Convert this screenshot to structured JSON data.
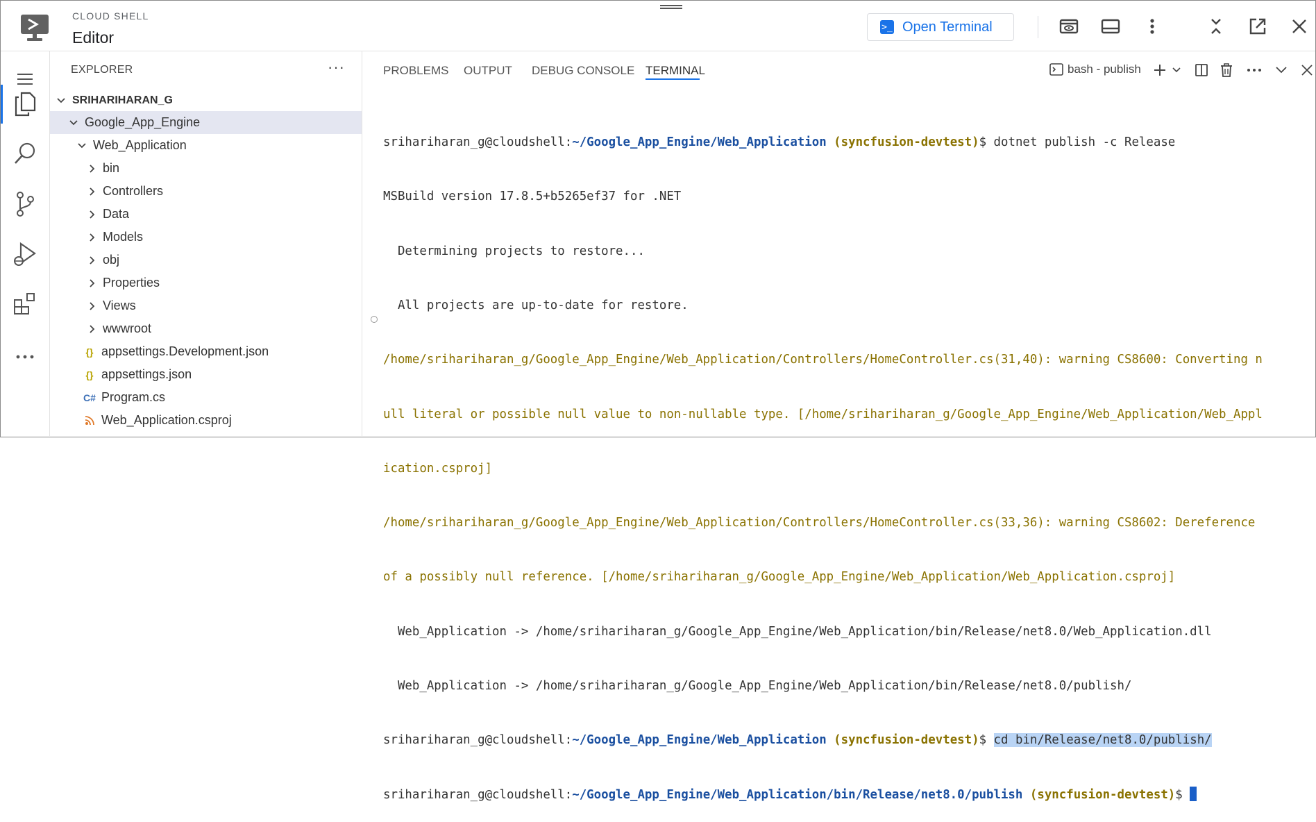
{
  "header": {
    "product": "CLOUD SHELL",
    "title": "Editor",
    "open_terminal_label": "Open Terminal"
  },
  "explorer": {
    "title": "EXPLORER",
    "root": "SRIHARIHARAN_G",
    "items": [
      {
        "label": "Google_App_Engine"
      },
      {
        "label": "Web_Application"
      },
      {
        "label": "bin"
      },
      {
        "label": "Controllers"
      },
      {
        "label": "Data"
      },
      {
        "label": "Models"
      },
      {
        "label": "obj"
      },
      {
        "label": "Properties"
      },
      {
        "label": "Views"
      },
      {
        "label": "wwwroot"
      },
      {
        "label": "appsettings.Development.json"
      },
      {
        "label": "appsettings.json"
      },
      {
        "label": "Program.cs"
      },
      {
        "label": "Web_Application.csproj"
      }
    ]
  },
  "panel": {
    "tabs": [
      {
        "label": "PROBLEMS"
      },
      {
        "label": "OUTPUT"
      },
      {
        "label": "DEBUG CONSOLE"
      },
      {
        "label": "TERMINAL"
      }
    ],
    "terminal_name": "bash - publish"
  },
  "terminal": {
    "user": "srihariharan_g@cloudshell:",
    "cwd1": "~/Google_App_Engine/Web_Application",
    "project": "(syncfusion-devtest)",
    "prompt_sign": "$ ",
    "cmd1": "dotnet publish -c Release",
    "out1": "MSBuild version 17.8.5+b5265ef37 for .NET",
    "out2": "  Determining projects to restore...",
    "out3": "  All projects are up-to-date for restore.",
    "warn1a": "/home/srihariharan_g/Google_App_Engine/Web_Application/Controllers/HomeController.cs(31,40): warning CS8600: Converting n",
    "warn1b": "ull literal or possible null value to non-nullable type. [/home/srihariharan_g/Google_App_Engine/Web_Application/Web_Appl",
    "warn1c": "ication.csproj]",
    "warn2a": "/home/srihariharan_g/Google_App_Engine/Web_Application/Controllers/HomeController.cs(33,36): warning CS8602: Dereference",
    "warn2b": "of a possibly null reference. [/home/srihariharan_g/Google_App_Engine/Web_Application/Web_Application.csproj]",
    "out4": "  Web_Application -> /home/srihariharan_g/Google_App_Engine/Web_Application/bin/Release/net8.0/Web_Application.dll",
    "out5": "  Web_Application -> /home/srihariharan_g/Google_App_Engine/Web_Application/bin/Release/net8.0/publish/",
    "cmd2": "cd bin/Release/net8.0/publish/",
    "cwd2": "~/Google_App_Engine/Web_Application/bin/Release/net8.0/publish"
  },
  "colors": {
    "accent": "#1a73e8",
    "path": "#1a4fa0",
    "project": "#8a7200",
    "selection": "#b9d4f5"
  }
}
